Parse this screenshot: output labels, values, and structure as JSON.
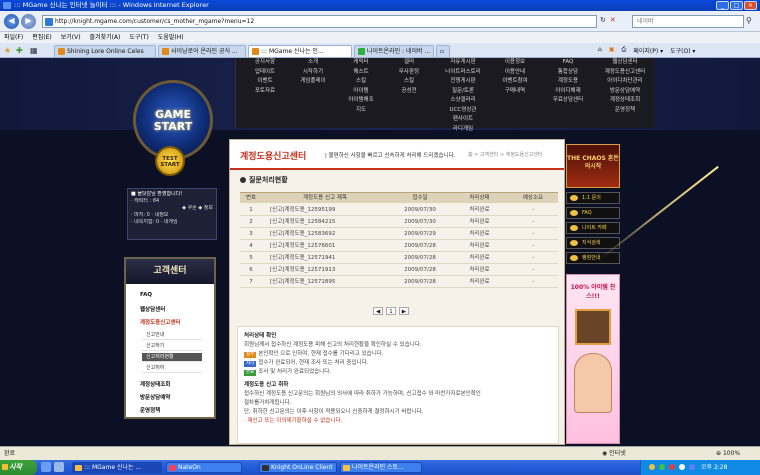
{
  "window": {
    "title": "::: MGame 신나는 인터넷 놀이터 ::: - Windows Internet Explorer"
  },
  "address": {
    "url": "http://knight.mgame.com/customer/cs_mother_mgame?menu=12",
    "search_placeholder": "네이버"
  },
  "menu": [
    "파일(F)",
    "편집(E)",
    "보기(V)",
    "즐겨찾기(A)",
    "도구(T)",
    "도움말(H)"
  ],
  "tabs": [
    {
      "label": "Shining Lore Online Celes"
    },
    {
      "label": "샤이닝로어 온라인 공식 ..."
    },
    {
      "label": "::: MGame 신나는 인..."
    },
    {
      "label": "나이트온라인 : 네이버 ..."
    }
  ],
  "tab_tools": {
    "page": "페이지(P) ▾",
    "tools": "도구(O) ▾"
  },
  "topnav": {
    "col1": [
      "공지사항",
      "업데이트",
      "이벤트",
      "포토자료"
    ],
    "col2": [
      "소개",
      "시작하기",
      "게임플레이"
    ],
    "col3": [
      "캐릭터",
      "퀘스트",
      "스킬",
      "아이템",
      "아이템해조",
      "지도"
    ],
    "col4": [
      "갤러",
      "무사판정",
      "스킬",
      "공성전"
    ],
    "col5": [
      "자유게시판",
      "나이트러스토리",
      "전쟁게시판",
      "질문/토론",
      "스샷갤러리",
      "UCC영상관",
      "팬사이트",
      "라디게임"
    ],
    "col6": [
      "이용정보",
      "이용안내",
      "이벤트참여",
      "구매내역"
    ],
    "col7": [
      "FAQ",
      "통합상담",
      "계정도용",
      "아이디해제",
      "무료상담센터"
    ],
    "col8": [
      "웹상담센터",
      "계정도용신고센터",
      "아이디차단관리",
      "방문상담예약",
      "계정상태조회",
      "운영정책"
    ]
  },
  "left": {
    "game_start": "GAME START",
    "test_start": "TEST START",
    "login_lines": [
      "■ 물닷감님 환영합니다!",
      "· 캐릭터 : 84",
      "◆ 쿠폰 ◆ 정보",
      "· 마지: 0      · 내정보",
      "· 내쪽지함: 0  · 내게임"
    ]
  },
  "sidebar": {
    "title": "고객센터",
    "items": [
      "FAQ",
      "웹상담센터",
      "계정도용신고센터",
      "계정상태조회",
      "방문상담예약",
      "운영정책"
    ],
    "sub_items": [
      "신고안내",
      "신고하기",
      "신고처리현황",
      "신고취하"
    ]
  },
  "main": {
    "title": "계정도용신고센터",
    "desc": "| 불편하신 사항을 빠르고 신속하게 처리해 드리겠습니다.",
    "breadcrumb": "홈 > 고객센터 > 계정도용신고센터",
    "section": "질문처리현황",
    "headers": [
      "번호",
      "계정도용 신고 제목",
      "접수일",
      "처리상태",
      "예상소요"
    ],
    "rows": [
      [
        "1",
        "[신고]계정도용_12595199",
        "2009/07/30",
        "처리완료",
        "-"
      ],
      [
        "2",
        "[신고]계정도용_12584215",
        "2009/07/30",
        "처리완료",
        "-"
      ],
      [
        "3",
        "[신고]계정도용_12583692",
        "2009/07/29",
        "처리완료",
        "-"
      ],
      [
        "4",
        "[신고]계정도용_12576601",
        "2009/07/28",
        "처리완료",
        "-"
      ],
      [
        "5",
        "[신고]계정도용_12571941",
        "2009/07/28",
        "처리완료",
        "-"
      ],
      [
        "6",
        "[신고]계정도용_12571913",
        "2009/07/28",
        "처리완료",
        "-"
      ],
      [
        "7",
        "[신고]계정도용_12571895",
        "2009/07/28",
        "처리완료",
        "-"
      ]
    ],
    "pager": {
      "prev": "◀",
      "page": "1",
      "next": "▶"
    },
    "info": {
      "h1": "처리상태 확인",
      "p1": "회원님께서 접수하신 계정도용 피해 신고의 처리현황을 확인하실 수 있습니다.",
      "b1": "접수",
      "t1": "본인확인 으로 인하여, 현재 접수를 기다리고 있습니다.",
      "b2": "처리",
      "t2": "접수가 완료되어, 현재 조사 또는 처리 중입니다.",
      "b3": "완료",
      "t3": "조사 및 처리가 완료되었습니다.",
      "h2": "계정도용 신고 취하",
      "p2": "접수하신 계정도용 신고문의는 회원님의 의사에 따라 취하가 가능하며, 신고접수 와 마찬가지로본인확인",
      "p3": "절차를거치게됩니다.",
      "p4": "단, 취하한 신고문의는 이후 사항이 적용되오니 신중하게 결정하시기 바랍니다.",
      "p5": "· 재신고 또는 이의제기할하실 수 없습니다."
    }
  },
  "right": {
    "chaos": "THE CHAOS 혼돈의시작",
    "buttons": [
      "1:1 문의",
      "FAQ",
      "나이트 카페",
      "지식검색",
      "랭킹안내"
    ],
    "promo": "100% 아이템 찬스!!!"
  },
  "status": {
    "left": "완료",
    "zone": "인터넷",
    "zoom": "100%"
  },
  "taskbar": {
    "start": "시작",
    "tasks": [
      "::: MGame 신나는 ...",
      "NateOn",
      "Knight OnLine Client",
      "나이트온라인 스토..."
    ],
    "clock": "오후 2:28"
  },
  "colors": {
    "accent": "#c4301c",
    "tab_active": "#ffffff"
  }
}
